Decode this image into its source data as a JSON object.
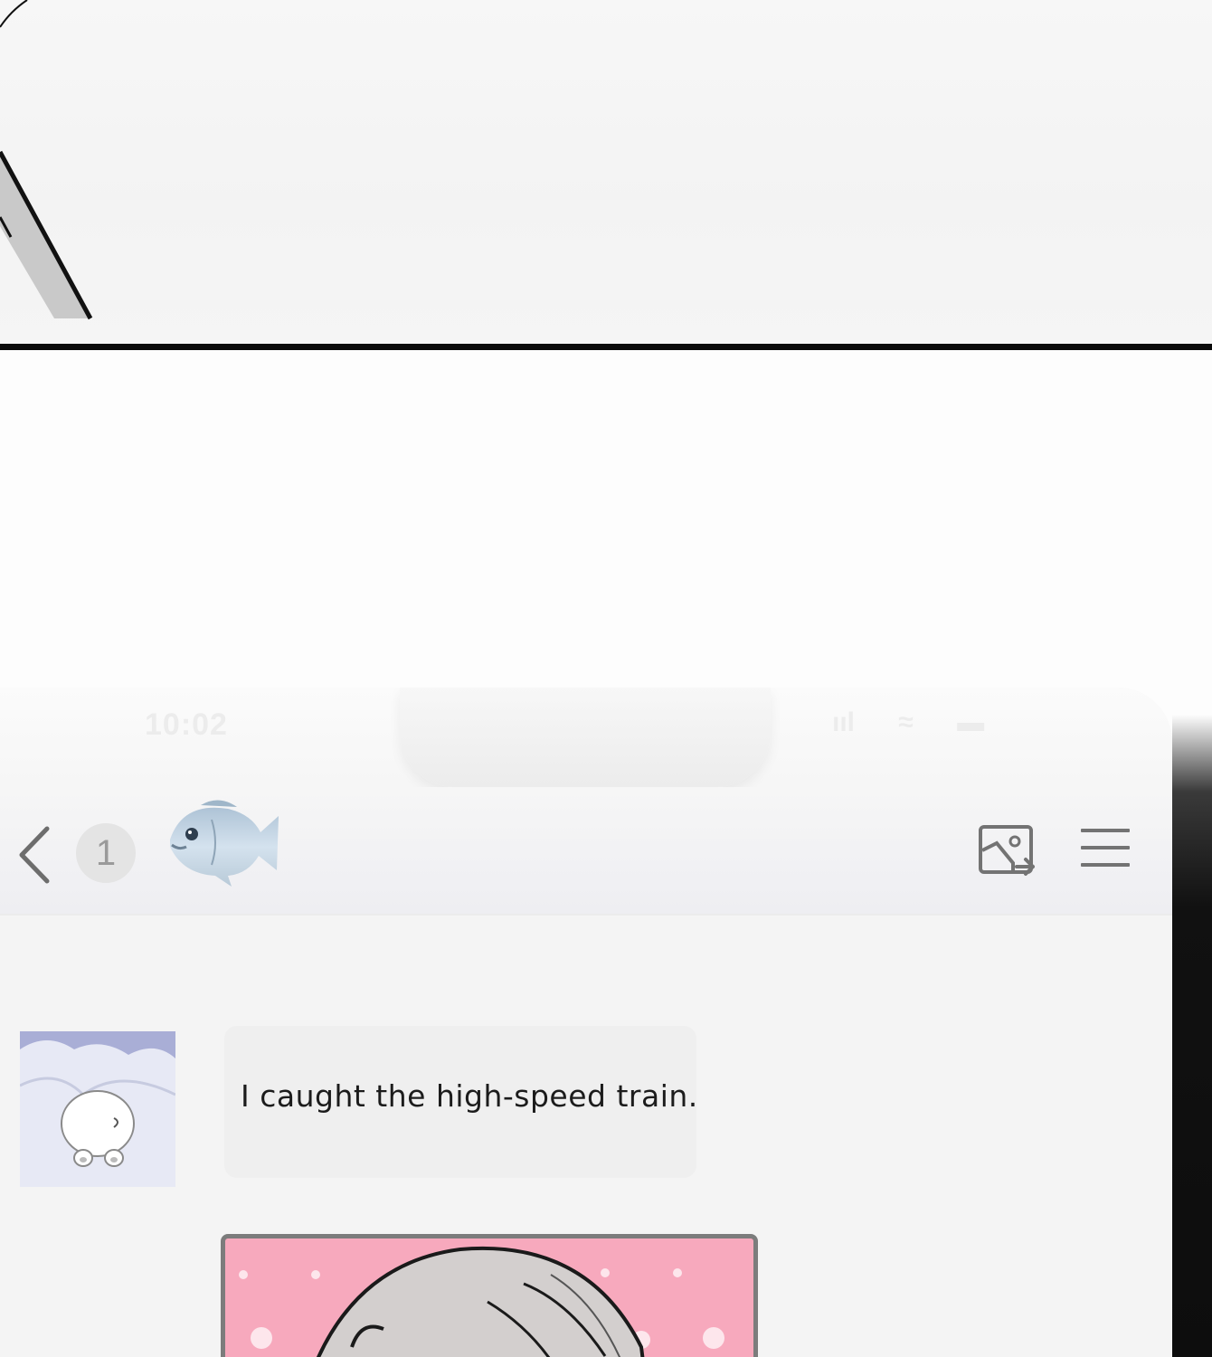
{
  "status_bar": {
    "time": "10:02",
    "signal": "ııl",
    "wifi": "≈",
    "battery": "▬"
  },
  "chat_header": {
    "unread_count": "1",
    "contact_avatar_icon": "fish-icon",
    "back_icon": "chevron-left-icon",
    "share_image_icon": "image-share-icon",
    "menu_icon": "hamburger-menu-icon"
  },
  "messages": [
    {
      "type": "text",
      "sender_avatar": "polar-bear-avatar",
      "text": "I caught the high-speed train."
    },
    {
      "type": "image",
      "content": "character-photo"
    }
  ],
  "colors": {
    "panel_border": "#0b0b0b",
    "screen_bg": "#f4f4f4",
    "bubble_bg": "#efefef",
    "photo_bg": "#f7a9bd",
    "icon_gray": "#737373"
  }
}
